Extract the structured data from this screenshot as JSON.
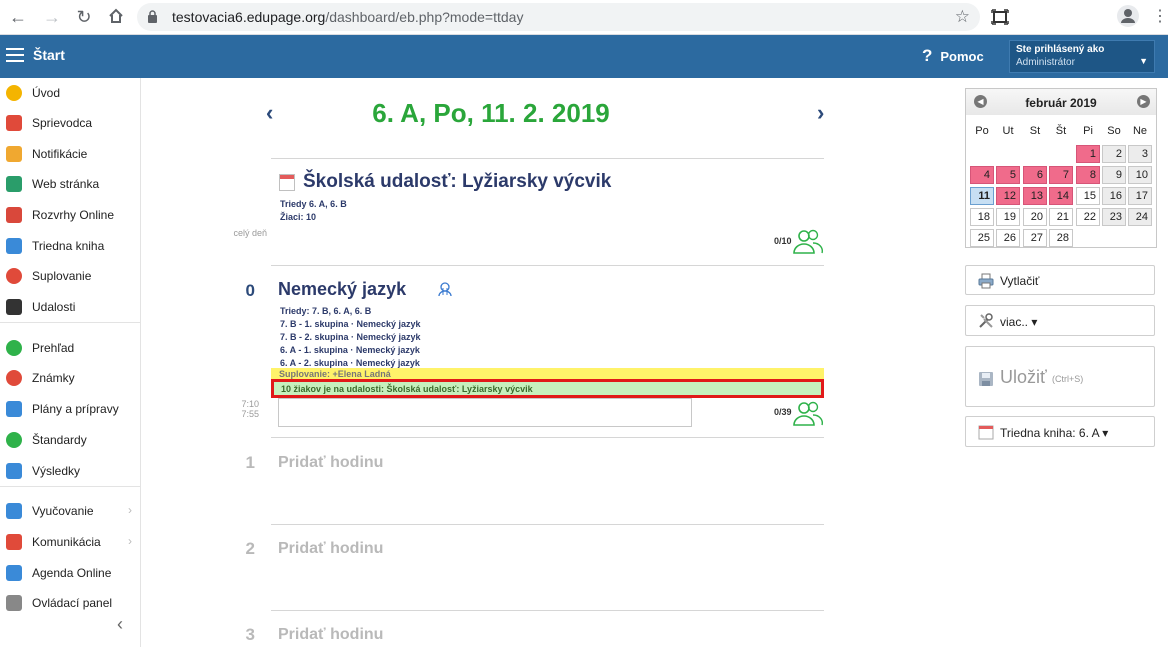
{
  "browser": {
    "url_host": "testovacia6.edupage.org",
    "url_path": "/dashboard/eb.php?mode=ttday"
  },
  "header": {
    "start_label": "Štart",
    "help_label": "Pomoc",
    "help_glyph": "?",
    "user_line1": "Ste prihlásený ako",
    "user_line2": "Administrátor"
  },
  "sidebar": {
    "items": [
      {
        "label": "Úvod",
        "icon": "star-icon",
        "color": "#f4b400"
      },
      {
        "label": "Sprievodca",
        "icon": "magic-wand-icon",
        "color": "#e04a3a"
      },
      {
        "label": "Notifikácie",
        "icon": "envelope-icon",
        "color": "#f0a830"
      },
      {
        "label": "Web stránka",
        "icon": "home-icon",
        "color": "#2a9d6a"
      },
      {
        "label": "Rozvrhy Online",
        "icon": "timetable-icon",
        "color": "#d9483b"
      },
      {
        "label": "Triedna kniha",
        "icon": "book-icon",
        "color": "#3a8ad8"
      },
      {
        "label": "Suplovanie",
        "icon": "substitute-icon",
        "color": "#e04a3a"
      },
      {
        "label": "Udalosti",
        "icon": "calendar-icon",
        "color": "#333333"
      },
      {
        "label": "Prehľad",
        "icon": "check-circle-icon",
        "color": "#2fb24a"
      },
      {
        "label": "Známky",
        "icon": "grades-icon",
        "color": "#e04a3a"
      },
      {
        "label": "Plány a prípravy",
        "icon": "briefcase-icon",
        "color": "#3a8ad8"
      },
      {
        "label": "Štandardy",
        "icon": "shield-check-icon",
        "color": "#2fb24a"
      },
      {
        "label": "Výsledky",
        "icon": "bar-chart-icon",
        "color": "#3a8ad8"
      },
      {
        "label": "Vyučovanie",
        "icon": "teaching-icon",
        "color": "#3a8ad8"
      },
      {
        "label": "Komunikácia",
        "icon": "chat-icon",
        "color": "#e04a3a"
      },
      {
        "label": "Agenda Online",
        "icon": "pen-icon",
        "color": "#3a8ad8"
      },
      {
        "label": "Ovládací panel",
        "icon": "gear-icon",
        "color": "#888888"
      }
    ]
  },
  "main": {
    "prev_glyph": "‹",
    "next_glyph": "›",
    "title": "6. A, Po, 11. 2. 2019",
    "allday_label": "celý deň",
    "event": {
      "title": "Školská udalosť: Lyžiarsky výcvik",
      "classes": "Triedy  6. A, 6. B",
      "students": "Žiaci:  10",
      "count": "0/10"
    },
    "lesson0": {
      "num": "0",
      "title": "Nemecký jazyk",
      "classes": "Triedy:  7. B, 6. A, 6. B",
      "groups": [
        "7. B - 1. skupina · Nemecký jazyk",
        "7. B - 2. skupina · Nemecký jazyk",
        "6. A - 1. skupina · Nemecký jazyk",
        "6. A - 2. skupina · Nemecký jazyk"
      ],
      "substitution": "Suplovanie:  +Elena Ladná",
      "event_notice": "10 žiakov je na udalosti: Školská udalosť: Lyžiarsky výcvik",
      "time_start": "7:10",
      "time_end": "7:55",
      "count": "0/39"
    },
    "empty_lessons": [
      {
        "num": "1",
        "label": "Pridať hodinu"
      },
      {
        "num": "2",
        "label": "Pridať hodinu"
      },
      {
        "num": "3",
        "label": "Pridať hodinu"
      }
    ]
  },
  "calendar": {
    "month": "február 2019",
    "dow": [
      "Po",
      "Ut",
      "St",
      "Št",
      "Pi",
      "So",
      "Ne"
    ],
    "weeks": [
      [
        "",
        "",
        "",
        "",
        "1",
        "2",
        "3"
      ],
      [
        "4",
        "5",
        "6",
        "7",
        "8",
        "9",
        "10"
      ],
      [
        "11",
        "12",
        "13",
        "14",
        "15",
        "16",
        "17"
      ],
      [
        "18",
        "19",
        "20",
        "21",
        "22",
        "23",
        "24"
      ],
      [
        "25",
        "26",
        "27",
        "28",
        "",
        "",
        ""
      ]
    ],
    "highlighted": [
      "1",
      "4",
      "5",
      "6",
      "7",
      "8",
      "12",
      "13",
      "14"
    ],
    "today": "11",
    "highlight_color": "#f06b8b"
  },
  "actions": {
    "print_label": "Vytlačiť",
    "more_label": "viac.. ▾",
    "save_label": "Uložiť",
    "save_shortcut": "(Ctrl+S)",
    "classbook_label": "Triedna kniha: 6. A ▾"
  }
}
